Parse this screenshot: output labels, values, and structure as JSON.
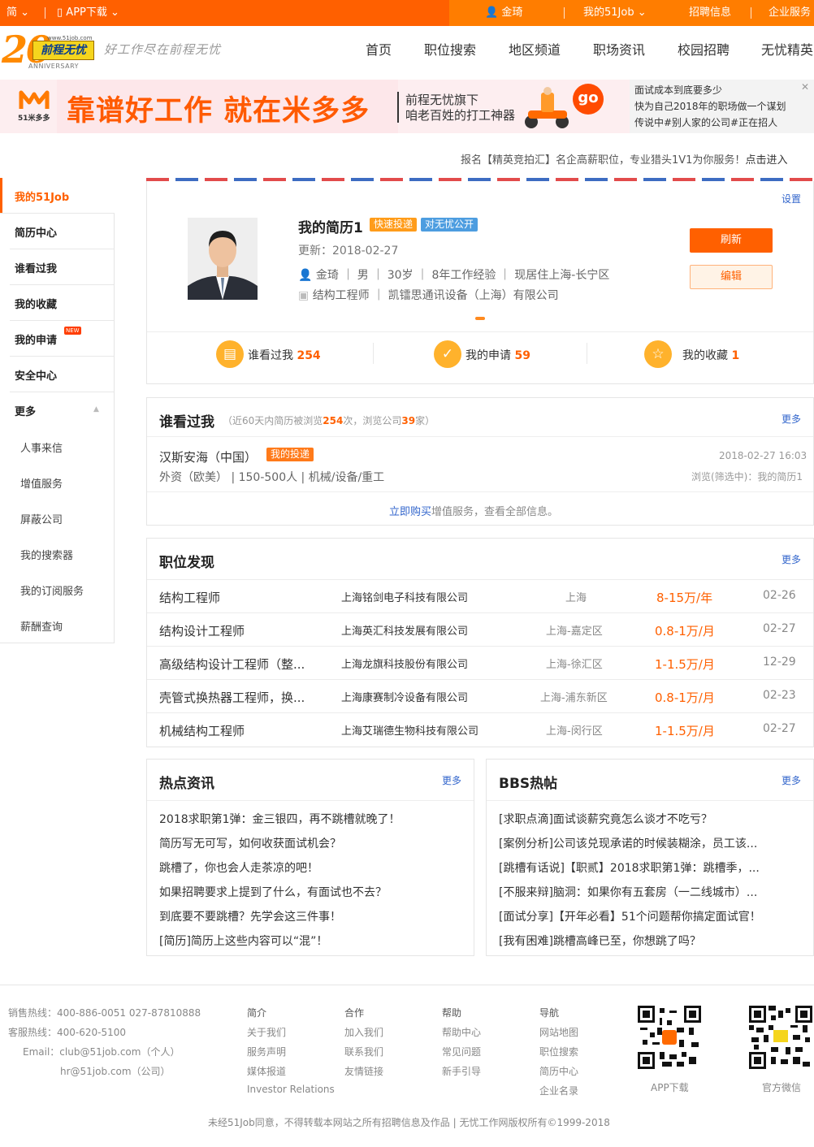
{
  "topbar": {
    "lang": "简",
    "app": "APP下载",
    "user": "金琦",
    "my51": "我的51Job",
    "recruit": "招聘信息",
    "enterprise": "企业服务"
  },
  "header": {
    "logo_url": "www.51job.com",
    "logo_text": "前程无忧",
    "anniversary": "ANNIVERSARY",
    "slogan": "好工作尽在前程无忧",
    "nav": [
      "首页",
      "职位搜索",
      "地区频道",
      "职场资讯",
      "校园招聘",
      "无忧精英"
    ]
  },
  "banner": {
    "logo_text": "51米多多",
    "main": "靠谱好工作 就在米多多",
    "sub1": "前程无忧旗下",
    "sub2": "咱老百姓的打工神器",
    "go": "go"
  },
  "ad": {
    "line1": "面试成本到底要多少",
    "line2": "快为自己2018年的职场做一个谋划",
    "line3": "传说中#别人家的公司#正在招人"
  },
  "notice": {
    "text": "报名【精英竞拍汇】名企高薪职位，专业猎头1V1为你服务！",
    "link": "点击进入"
  },
  "sidebar": {
    "items": [
      "我的51Job",
      "简历中心",
      "谁看过我",
      "我的收藏",
      "我的申请",
      "安全中心",
      "更多"
    ],
    "new_badge": "NEW",
    "sub_items": [
      "人事来信",
      "增值服务",
      "屏蔽公司",
      "我的搜索器",
      "我的订阅服务",
      "薪酬查询"
    ]
  },
  "profile": {
    "settings": "设置",
    "title": "我的简历1",
    "tag1": "快速投递",
    "tag2": "对无忧公开",
    "updated_label": "更新：",
    "updated": "2018-02-27",
    "name": "金琦",
    "gender": "男",
    "age": "30岁",
    "exp": "8年工作经验",
    "location": "现居住上海-长宁区",
    "job": "结构工程师",
    "company": "凯镭思通讯设备（上海）有限公司",
    "refresh": "刷新",
    "edit": "编辑",
    "stats": [
      {
        "label": "谁看过我",
        "value": "254"
      },
      {
        "label": "我的申请",
        "value": "59"
      },
      {
        "label": "我的收藏",
        "value": "1"
      }
    ]
  },
  "viewers": {
    "title": "谁看过我",
    "note_pre": "（近60天内简历被浏览",
    "views": "254",
    "note_mid": "次，浏览公司",
    "companies": "39",
    "note_post": "家）",
    "more": "更多",
    "company": "汉斯安海（中国）",
    "badge": "我的投递",
    "date": "2018-02-27 16:03",
    "info": "外资（欧美） | 150-500人 | 机械/设备/重工",
    "viewed": "浏览(筛选中)：我的简历1",
    "buy_link": "立即购买",
    "buy_text": "增值服务，查看全部信息。"
  },
  "jobs": {
    "title": "职位发现",
    "more": "更多",
    "rows": [
      {
        "title": "结构工程师",
        "company": "上海铭剑电子科技有限公司",
        "city": "上海",
        "salary": "8-15万/年",
        "date": "02-26"
      },
      {
        "title": "结构设计工程师",
        "company": "上海英汇科技发展有限公司",
        "city": "上海-嘉定区",
        "salary": "0.8-1万/月",
        "date": "02-27"
      },
      {
        "title": "高级结构设计工程师（整...",
        "company": "上海龙旗科技股份有限公司",
        "city": "上海-徐汇区",
        "salary": "1-1.5万/月",
        "date": "12-29"
      },
      {
        "title": "壳管式换热器工程师，换...",
        "company": "上海康赛制冷设备有限公司",
        "city": "上海-浦东新区",
        "salary": "0.8-1万/月",
        "date": "02-23"
      },
      {
        "title": "机械结构工程师",
        "company": "上海艾瑞德生物科技有限公司",
        "city": "上海-闵行区",
        "salary": "1-1.5万/月",
        "date": "02-27"
      }
    ]
  },
  "news": {
    "title": "热点资讯",
    "more": "更多",
    "items": [
      "2018求职第1弹：金三银四，再不跳槽就晚了！",
      "简历写无可写，如何收获面试机会？",
      "跳槽了，你也会人走茶凉的吧！",
      "如果招聘要求上提到了什么，有面试也不去？",
      "到底要不要跳槽？先学会这三件事！",
      "[简历]简历上这些内容可以“混”！"
    ]
  },
  "bbs": {
    "title": "BBS热帖",
    "more": "更多",
    "items": [
      "[求职点滴]面试谈薪究竟怎么谈才不吃亏？",
      "[案例分析]公司该兑现承诺的时候装糊涂，员工该...",
      "[跳槽有话说]【职贰】2018求职第1弹：跳槽季，...",
      "[不服来辩]脑洞：如果你有五套房（一二线城市）...",
      "[面试分享]【开年必看】51个问题帮你搞定面试官！",
      "[我有困难]跳槽高峰已至，你想跳了吗？"
    ]
  },
  "footer": {
    "sales_label": "销售热线：",
    "sales": "400-886-0051  027-87810888",
    "cs_label": "客服热线：",
    "cs": "400-620-5100",
    "email_label": "Email：",
    "email1": "club@51job.com（个人）",
    "email2": "hr@51job.com（公司）",
    "cols": [
      {
        "title": "简介",
        "links": [
          "关于我们",
          "服务声明",
          "媒体报道",
          "Investor Relations"
        ]
      },
      {
        "title": "合作",
        "links": [
          "加入我们",
          "联系我们",
          "友情链接"
        ]
      },
      {
        "title": "帮助",
        "links": [
          "帮助中心",
          "常见问题",
          "新手引导"
        ]
      },
      {
        "title": "导航",
        "links": [
          "网站地图",
          "职位搜索",
          "简历中心",
          "企业名录"
        ]
      }
    ],
    "qr1": "APP下载",
    "qr2": "官方微信",
    "copyright": "未经51Job同意，不得转载本网站之所有招聘信息及作品 | 无忧工作网版权所有©1999-2018"
  }
}
